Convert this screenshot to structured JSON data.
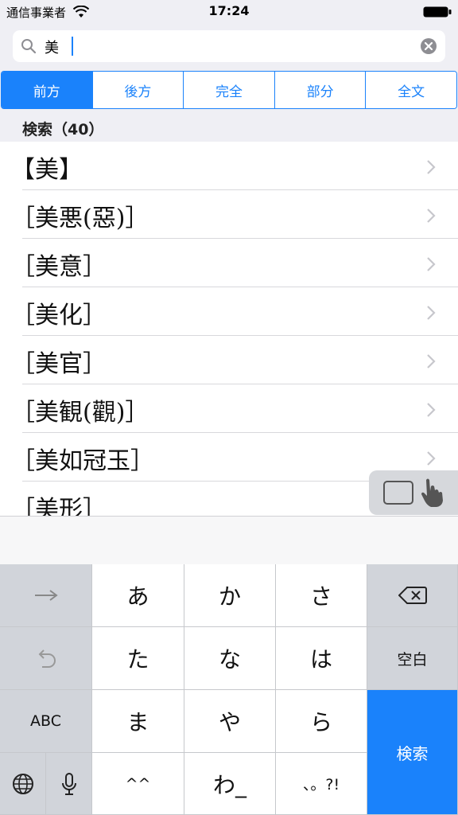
{
  "status": {
    "carrier": "通信事業者",
    "time": "17:24"
  },
  "search": {
    "query": "美"
  },
  "segments": [
    {
      "label": "前方",
      "active": true
    },
    {
      "label": "後方",
      "active": false
    },
    {
      "label": "完全",
      "active": false
    },
    {
      "label": "部分",
      "active": false
    },
    {
      "label": "全文",
      "active": false
    }
  ],
  "results": {
    "header": "検索（40）",
    "items": [
      "【美】",
      "［美悪(惡)］",
      "［美意］",
      "［美化］",
      "［美官］",
      "［美観(觀)］",
      "［美如冠玉］",
      "［美形］"
    ]
  },
  "keyboard": {
    "row1": [
      "あ",
      "か",
      "さ"
    ],
    "row2": [
      "た",
      "な",
      "は"
    ],
    "row3": [
      "ま",
      "や",
      "ら"
    ],
    "row4": [
      "^^",
      "わ_",
      "、。?!"
    ],
    "space_label": "空白",
    "abc_label": "ABC",
    "search_label": "検索"
  },
  "colors": {
    "accent": "#1a82fb"
  }
}
